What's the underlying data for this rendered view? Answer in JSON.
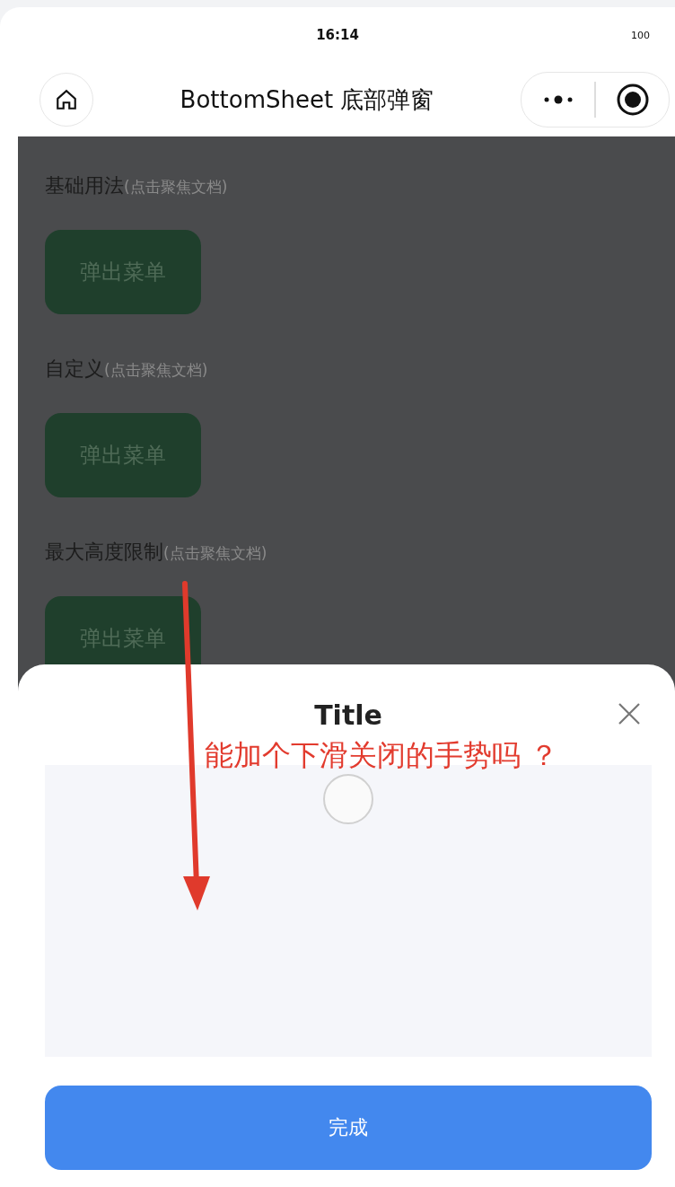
{
  "status_bar": {
    "time": "16:14",
    "battery": "100"
  },
  "nav_bar": {
    "title": "BottomSheet 底部弹窗"
  },
  "sections": [
    {
      "title": "基础用法",
      "hint": "(点击聚焦文档)",
      "button": "弹出菜单"
    },
    {
      "title": "自定义",
      "hint": "(点击聚焦文档)",
      "button": "弹出菜单"
    },
    {
      "title": "最大高度限制",
      "hint": "(点击聚焦文档)",
      "button": "弹出菜单"
    }
  ],
  "bottom_sheet": {
    "title": "Title",
    "loading": true,
    "confirm_button": "完成"
  },
  "annotation": {
    "text": "能加个下滑关闭的手势吗 ？"
  }
}
